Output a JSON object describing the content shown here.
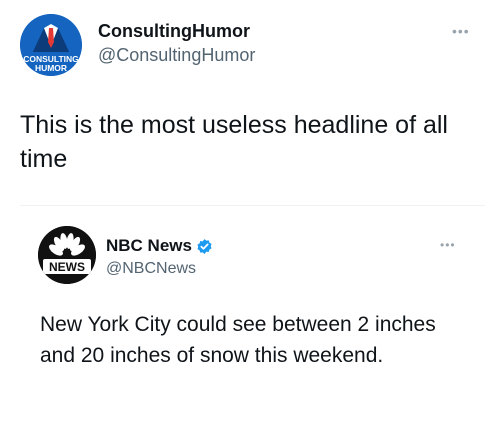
{
  "tweet": {
    "author": {
      "name": "ConsultingHumor",
      "handle": "@ConsultingHumor",
      "avatar_text_line1": "CONSULTING",
      "avatar_text_line2": "HUMOR"
    },
    "text": "This is the most useless headline of all time",
    "more_icon": "more-horizontal-icon"
  },
  "quoted_tweet": {
    "author": {
      "name": "NBC News",
      "handle": "@NBCNews",
      "verified": true,
      "avatar_text": "NEWS"
    },
    "text": "New York City could see between 2 inches and 20 inches of snow this weekend.",
    "more_icon": "more-horizontal-icon"
  },
  "colors": {
    "text_primary": "#0f1419",
    "text_secondary": "#536471",
    "verified_blue": "#1d9bf0",
    "consulting_blue": "#1565c0",
    "consulting_red": "#e53935",
    "nbc_black": "#111111"
  }
}
